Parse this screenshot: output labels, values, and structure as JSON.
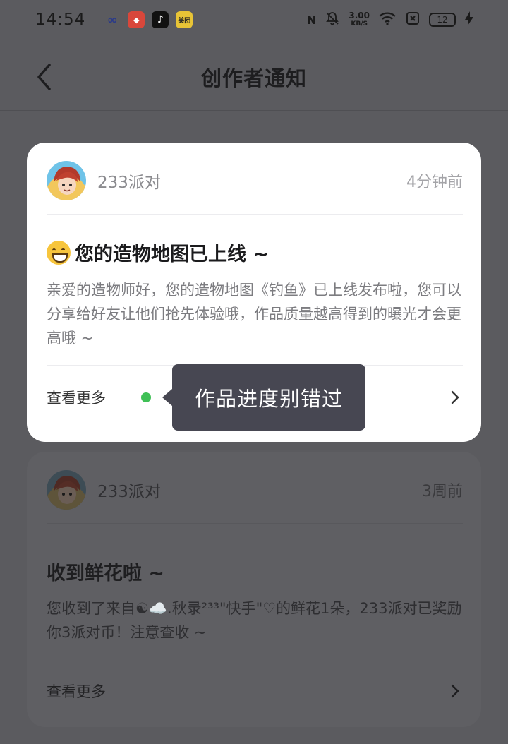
{
  "status_bar": {
    "time": "14:54",
    "net_speed_value": "3.00",
    "net_speed_unit": "KB/S",
    "battery": "12",
    "app_icons": [
      "baidu-netdisk-icon",
      "game-app-icon",
      "tiktok-icon",
      "meituan-icon"
    ],
    "meituan_label": "美团"
  },
  "header": {
    "title": "创作者通知"
  },
  "notifications": [
    {
      "source": "233派对",
      "time": "4分钟前",
      "title": "您的造物地图已上线 ~",
      "body": "亲爱的造物师好，您的造物地图《钓鱼》已上线发布啦，您可以分享给好友让他们抢先体验哦，作品质量越高得到的曝光才会更高哦 ~",
      "more_label": "查看更多",
      "unread": true
    },
    {
      "source": "233派对",
      "time": "3周前",
      "title": "收到鲜花啦 ~",
      "body": "您收到了来自☯☁️.秋录²³³\"快手\"♡的鲜花1朵，233派对已奖励你3派对币！注意查收 ~",
      "more_label": "查看更多",
      "unread": false
    }
  ],
  "tooltip": {
    "text": "作品进度别错过"
  },
  "colors": {
    "overlay": "#5b5b5f",
    "card": "#ffffff",
    "tooltip": "#474752",
    "unread_dot": "#3fc056"
  }
}
